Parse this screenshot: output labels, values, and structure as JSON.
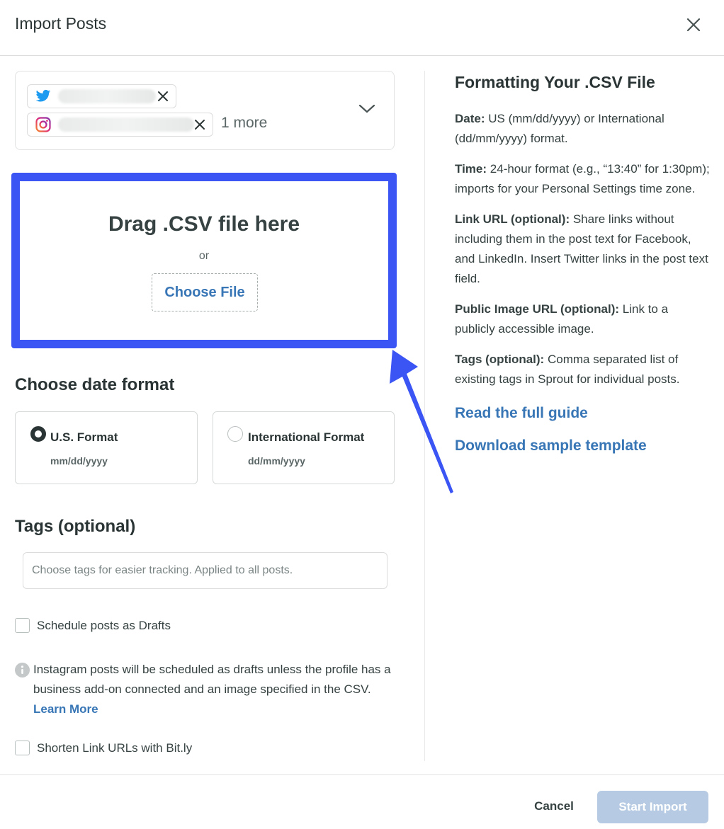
{
  "header": {
    "title": "Import Posts"
  },
  "profiles": {
    "chips": [
      {
        "network": "Twitter"
      },
      {
        "network": "Instagram"
      }
    ],
    "more_label": "1 more"
  },
  "dropzone": {
    "title": "Drag .CSV file here",
    "or_label": "or",
    "choose_label": "Choose File"
  },
  "date_format": {
    "heading": "Choose date format",
    "options": [
      {
        "label": "U.S. Format",
        "sub": "mm/dd/yyyy",
        "selected": true
      },
      {
        "label": "International Format",
        "sub": "dd/mm/yyyy",
        "selected": false
      }
    ]
  },
  "tags": {
    "heading": "Tags (optional)",
    "placeholder": "Choose tags for easier tracking. Applied to all posts.",
    "value": ""
  },
  "drafts": {
    "label": "Schedule posts as Drafts",
    "checked": false
  },
  "info": {
    "text": "Instagram posts will be scheduled as drafts unless the profile has a business add-on connected and an image specified in the CSV.",
    "link": "Learn More"
  },
  "bitly": {
    "label": "Shorten Link URLs with Bit.ly",
    "checked": false
  },
  "guide": {
    "title": "Formatting Your .CSV File",
    "items": [
      {
        "term": "Date:",
        "desc": "US (mm/dd/yyyy) or International (dd/mm/yyyy) format."
      },
      {
        "term": "Time:",
        "desc": "24-hour format (e.g., “13:40” for 1:30pm); imports for your Personal Settings time zone."
      },
      {
        "term": "Link URL (optional):",
        "desc": "Share links without including them in the post text for Facebook, and LinkedIn. Insert Twitter links in the post text field."
      },
      {
        "term": "Public Image URL (optional):",
        "desc": "Link to a publicly accessible image."
      },
      {
        "term": "Tags (optional):",
        "desc": "Comma separated list of existing tags in Sprout for individual posts."
      }
    ],
    "read_guide": "Read the full guide",
    "download_template": "Download sample template"
  },
  "footer": {
    "cancel": "Cancel",
    "start": "Start Import"
  },
  "colors": {
    "accent": "#3876b6",
    "highlight": "#3b55f5",
    "start_disabled": "#b6cbe3"
  }
}
